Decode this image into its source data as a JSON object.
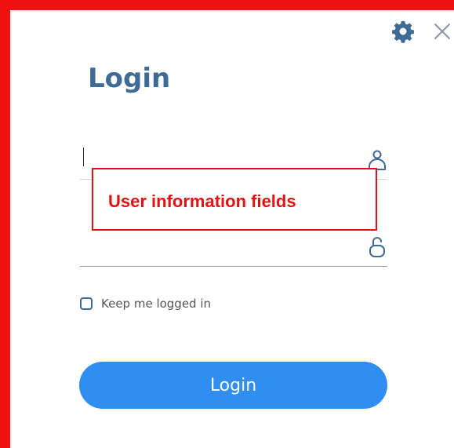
{
  "dialog": {
    "title": "Login",
    "settings_icon": "gear-icon",
    "close_icon": "close-icon"
  },
  "form": {
    "username": {
      "value": "",
      "icon": "user-icon"
    },
    "password": {
      "value": "",
      "icon": "lock-icon"
    },
    "remember": {
      "label": "Keep me logged in",
      "checked": false
    },
    "submit_label": "Login"
  },
  "annotation": {
    "text": "User information fields"
  },
  "colors": {
    "accent": "#2f8ef0",
    "title": "#3e6b95",
    "annotation": "#e31212",
    "frame": "#ee1111"
  }
}
